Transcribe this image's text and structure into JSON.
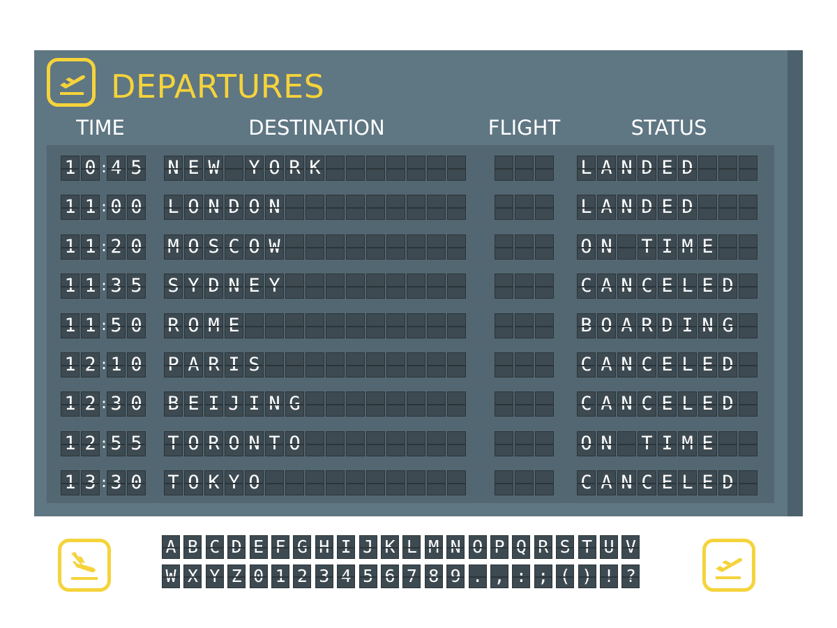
{
  "header": {
    "title": "DEPARTURES",
    "icon": "takeoff-icon"
  },
  "columns": {
    "time": "TIME",
    "destination": "DESTINATION",
    "flight": "FLIGHT",
    "status": "STATUS"
  },
  "colors": {
    "board": "#5f7683",
    "panel": "#536772",
    "tile": "#3d4a51",
    "accent": "#f5d33b",
    "text": "#ffffff"
  },
  "flights": [
    {
      "time": "10:45",
      "destination": "NEW YORK",
      "flight": "",
      "status": "LANDED"
    },
    {
      "time": "11:00",
      "destination": "LONDON",
      "flight": "",
      "status": "LANDED"
    },
    {
      "time": "11:20",
      "destination": "MOSCOW",
      "flight": "",
      "status": "ON TIME"
    },
    {
      "time": "11:35",
      "destination": "SYDNEY",
      "flight": "",
      "status": "CANCELED"
    },
    {
      "time": "11:50",
      "destination": "ROME",
      "flight": "",
      "status": "BOARDING"
    },
    {
      "time": "12:10",
      "destination": "PARIS",
      "flight": "",
      "status": "CANCELED"
    },
    {
      "time": "12:30",
      "destination": "BEIJING",
      "flight": "",
      "status": "CANCELED"
    },
    {
      "time": "12:55",
      "destination": "TORONTO",
      "flight": "",
      "status": "ON TIME"
    },
    {
      "time": "13:30",
      "destination": "TOKYO",
      "flight": "",
      "status": "CANCELED"
    }
  ],
  "alphabet": {
    "row1": "ABCDEFGHIJKLMNOPQRSTUV",
    "row2": "WXYZ0123456789.,:;()!?"
  },
  "icons": {
    "left": "landing-icon",
    "right": "takeoff-icon"
  }
}
